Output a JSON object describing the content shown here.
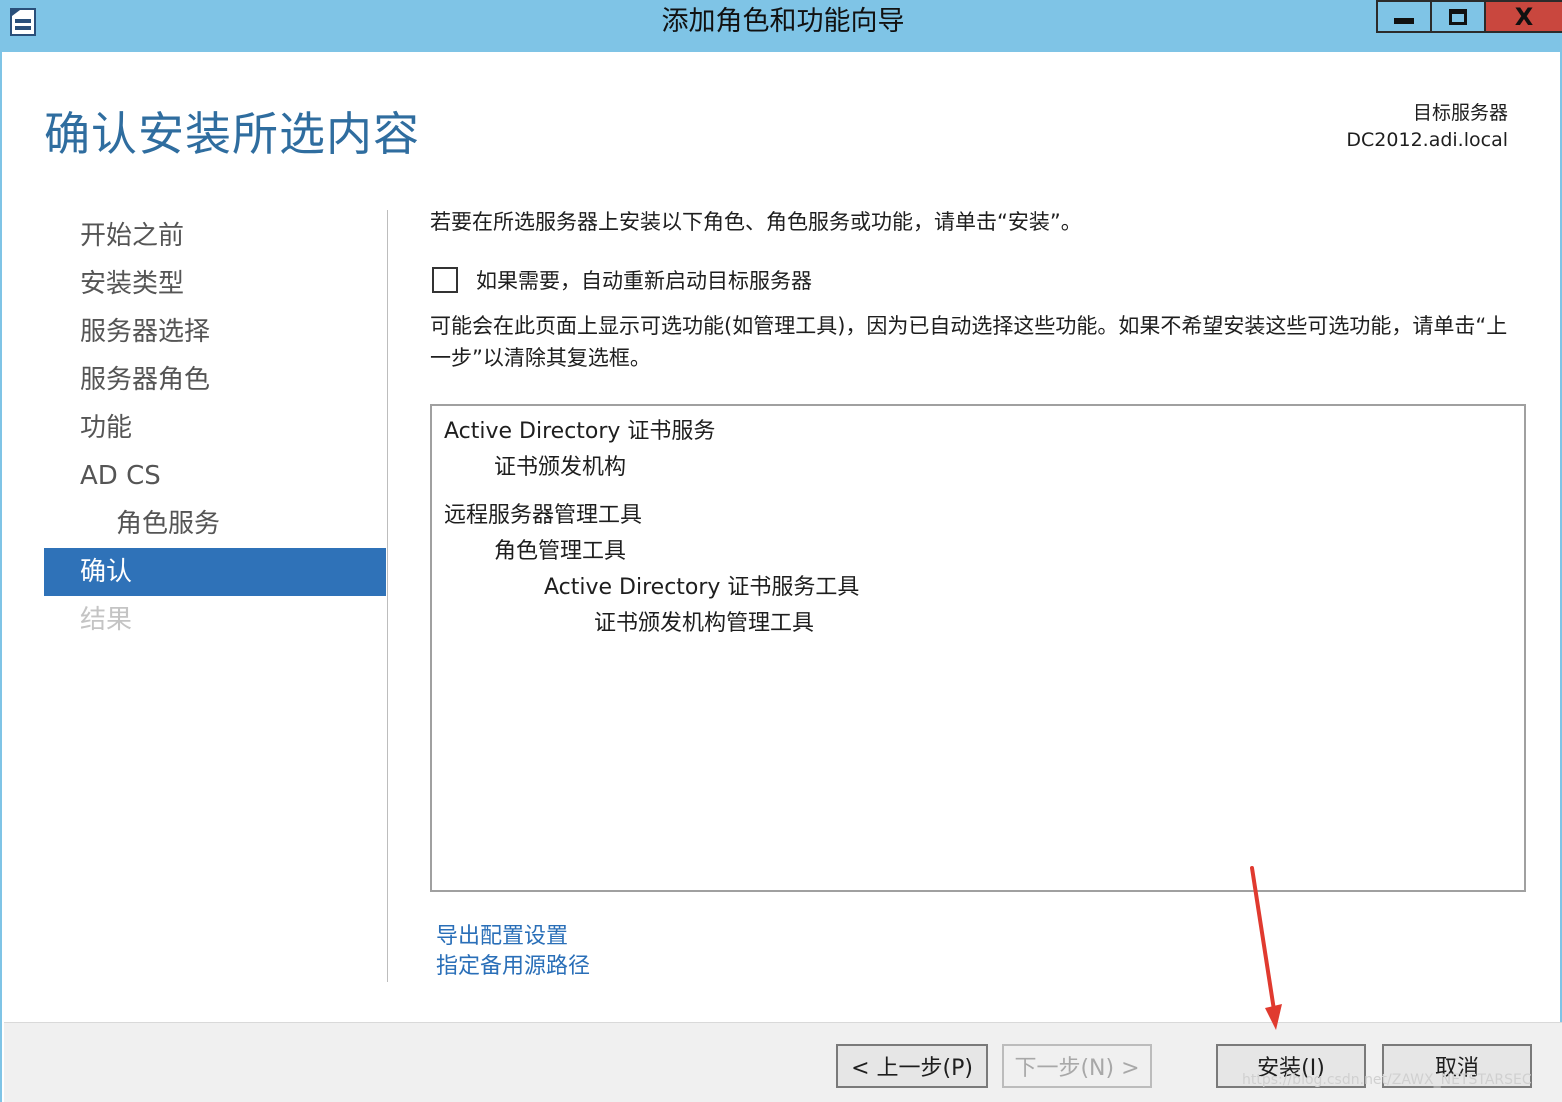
{
  "window": {
    "title": "添加角色和功能向导",
    "close_glyph": "X"
  },
  "header": {
    "page_title": "确认安装所选内容",
    "target_label": "目标服务器",
    "target_server": "DC2012.adi.local"
  },
  "nav": {
    "items": [
      {
        "label": "开始之前"
      },
      {
        "label": "安装类型"
      },
      {
        "label": "服务器选择"
      },
      {
        "label": "服务器角色"
      },
      {
        "label": "功能"
      },
      {
        "label": "AD CS"
      },
      {
        "label": "角色服务"
      },
      {
        "label": "确认"
      },
      {
        "label": "结果"
      }
    ],
    "active_index": 7
  },
  "content": {
    "intro": "若要在所选服务器上安装以下角色、角色服务或功能，请单击“安装”。",
    "restart_label": "如果需要，自动重新启动目标服务器",
    "restart_checked": false,
    "note": "可能会在此页面上显示可选功能(如管理工具)，因为已自动选择这些功能。如果不希望安装这些可选功能，请单击“上一步”以清除其复选框。",
    "list": [
      {
        "text": "Active Directory 证书服务",
        "level": 0
      },
      {
        "text": "证书颁发机构",
        "level": 1
      },
      {
        "text": "远程服务器管理工具",
        "level": 0
      },
      {
        "text": "角色管理工具",
        "level": 1
      },
      {
        "text": "Active Directory 证书服务工具",
        "level": 2
      },
      {
        "text": "证书颁发机构管理工具",
        "level": 3
      }
    ],
    "links": {
      "export": "导出配置设置",
      "alt_source": "指定备用源路径"
    }
  },
  "footer": {
    "prev": "< 上一步(P)",
    "next": "下一步(N) >",
    "install": "安装(I)",
    "cancel": "取消"
  },
  "watermark": "https://blog.csdn.net/ZAWX_NETSTARSEC",
  "colors": {
    "titlebar": "#7fc4e6",
    "accent": "#2f72b8",
    "title_text": "#2f6d9f",
    "link": "#2a6fb8",
    "annotation_arrow": "#e03a2f"
  }
}
